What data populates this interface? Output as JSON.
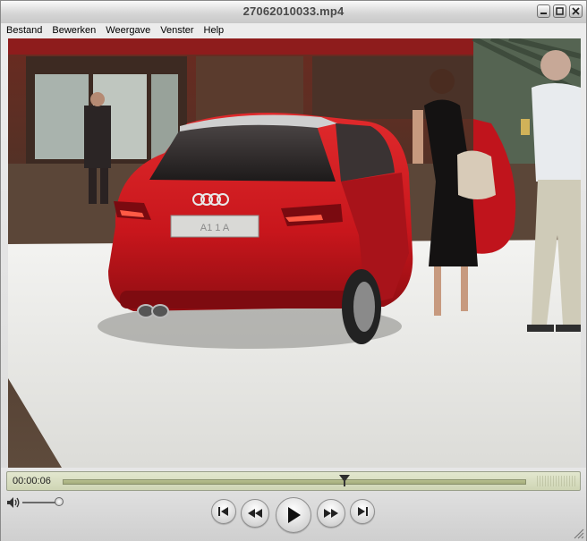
{
  "window": {
    "title": "27062010033.mp4"
  },
  "menu": {
    "items": [
      "Bestand",
      "Bewerken",
      "Weergave",
      "Venster",
      "Help"
    ]
  },
  "video": {
    "plate_text": "A1 1 A"
  },
  "player": {
    "current_time": "00:00:06",
    "progress": 0.6
  },
  "colors": {
    "car_red": "#c8161c",
    "seek_bg": "#d8ddc0"
  }
}
